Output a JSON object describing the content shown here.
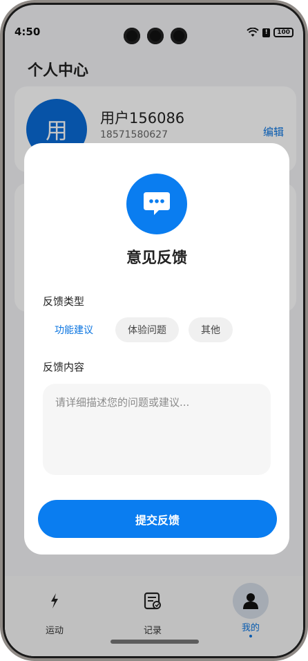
{
  "status_bar": {
    "time": "4:50",
    "alert": "!",
    "battery": "100"
  },
  "header": {
    "title": "个人中心"
  },
  "profile": {
    "avatar_text": "用",
    "name": "用户156086",
    "phone": "18571580627",
    "edit_label": "编辑"
  },
  "modal": {
    "icon": "chat-bubble-icon",
    "title": "意见反馈",
    "type_label": "反馈类型",
    "types": [
      "功能建议",
      "体验问题",
      "其他"
    ],
    "selected_type": "功能建议",
    "content_label": "反馈内容",
    "content_placeholder": "请详细描述您的问题或建议...",
    "content_value": "",
    "submit_label": "提交反馈"
  },
  "tab_bar": {
    "items": [
      {
        "label": "运动",
        "icon": "lightning-icon"
      },
      {
        "label": "记录",
        "icon": "record-icon"
      },
      {
        "label": "我的",
        "icon": "person-icon"
      }
    ],
    "active": "我的"
  },
  "colors": {
    "primary": "#0a7df0",
    "avatar": "#0a6bd6",
    "link": "#0a74e0"
  }
}
